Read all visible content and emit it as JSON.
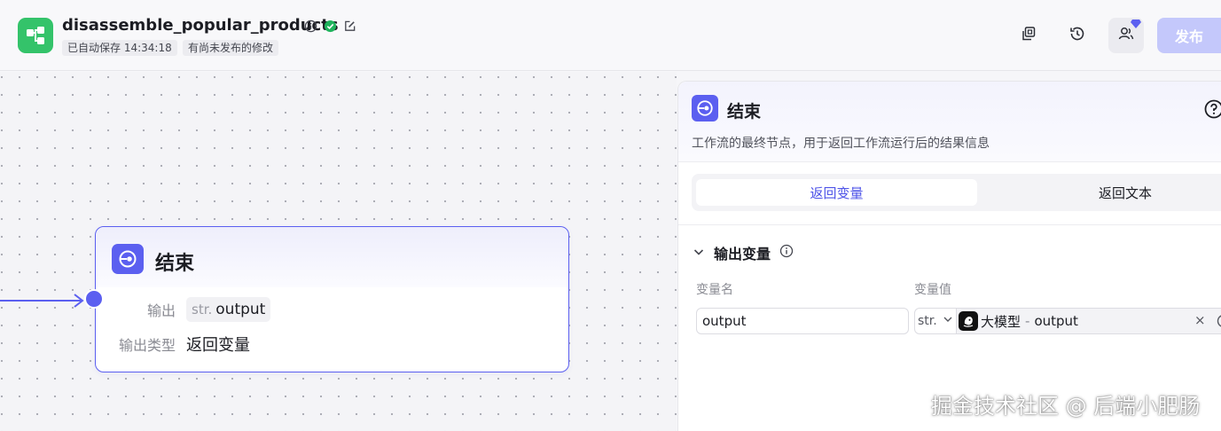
{
  "header": {
    "workflow_name": "disassemble_popular_products",
    "autosave_text": "已自动保存 14:34:18",
    "unpublished_text": "有尚未发布的修改",
    "publish_label": "发布",
    "icons": [
      "info-icon",
      "check-circle-icon",
      "edit-icon",
      "copy-icon",
      "history-icon",
      "collaborators-icon"
    ],
    "colors": {
      "logo": "#34c36a",
      "publish_disabled": "#c4c8fb"
    }
  },
  "canvas": {
    "end_node": {
      "title": "结束",
      "rows": [
        {
          "label": "输出",
          "type": "str.",
          "value": "output"
        },
        {
          "label": "输出类型",
          "value": "返回变量"
        }
      ]
    },
    "colors": {
      "accent": "#5b5ff0"
    }
  },
  "panel": {
    "title": "结束",
    "description": "工作流的最终节点，用于返回工作流运行后的结果信息",
    "tabs": [
      {
        "label": "返回变量",
        "active": true
      },
      {
        "label": "返回文本",
        "active": false
      }
    ],
    "section": {
      "title": "输出变量",
      "col_name": "变量名",
      "col_value": "变量值",
      "variable": {
        "name": "output",
        "type": "str.",
        "source_node": "大模型",
        "separator": "-",
        "source_field": "output",
        "clear": "×"
      }
    }
  },
  "watermark": "掘金技术社区 @ 后端小肥肠"
}
